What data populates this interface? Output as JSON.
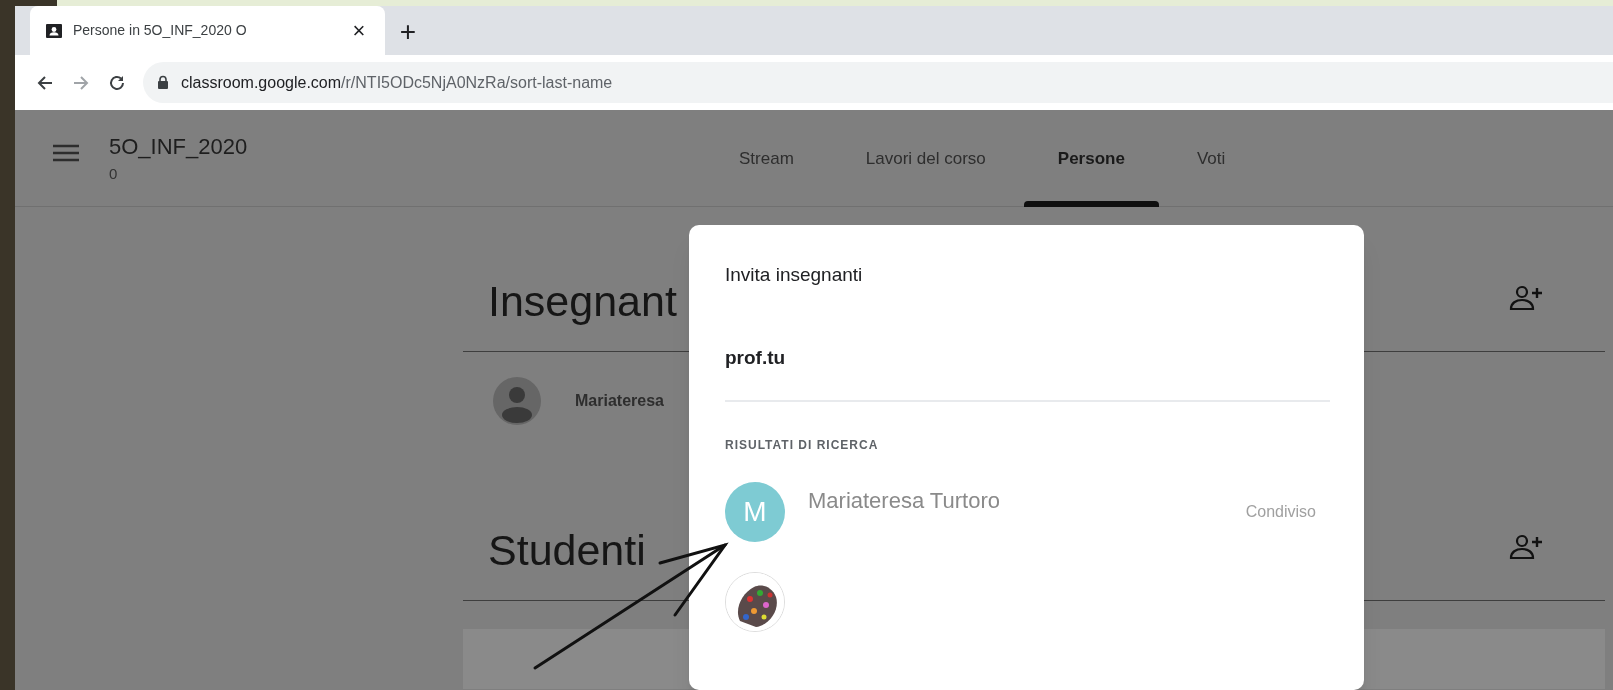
{
  "browser": {
    "tab_title": "Persone in 5O_INF_2020 O",
    "close": "×",
    "new_tab": "+",
    "url": "classroom.google.com/r/NTI5ODc5NjA0NzRa/sort-last-name"
  },
  "class": {
    "title": "5O_INF_2020",
    "subtitle": "0"
  },
  "nav_tabs": [
    {
      "label": "Stream",
      "selected": false
    },
    {
      "label": "Lavori del corso",
      "selected": false
    },
    {
      "label": "Persone",
      "selected": true
    },
    {
      "label": "Voti",
      "selected": false
    }
  ],
  "sections": [
    {
      "heading": "Insegnant",
      "members": [
        {
          "name": "Mariateresa"
        }
      ]
    },
    {
      "heading": "Studenti"
    }
  ],
  "dialog": {
    "title": "Invita insegnanti",
    "input_value": "prof.tu",
    "results_label": "RISULTATI DI RICERCA",
    "results": [
      {
        "kind": "letter",
        "initial": "M",
        "color": "#7ecbd3",
        "name": "Mariateresa Turtoro",
        "status": "Condiviso"
      },
      {
        "kind": "picture"
      }
    ]
  }
}
